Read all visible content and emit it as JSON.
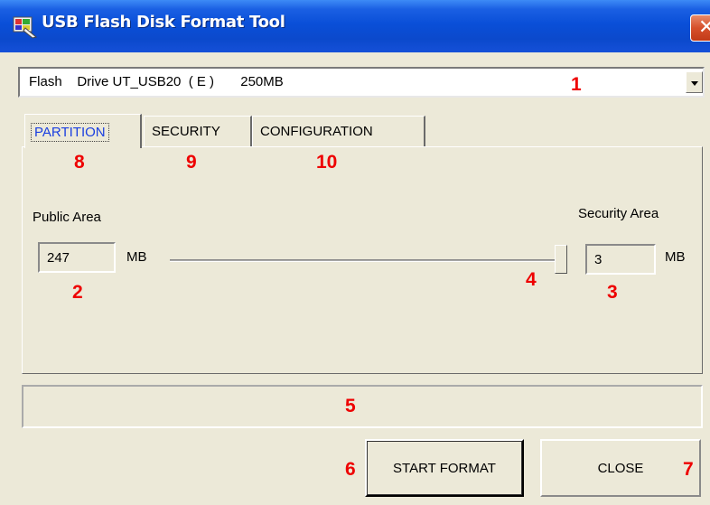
{
  "window": {
    "title": "USB Flash Disk Format Tool"
  },
  "drive": {
    "selected": "Flash    Drive UT_USB20  ( E )       250MB"
  },
  "tabs": [
    {
      "label": "PARTITION",
      "active": true
    },
    {
      "label": "SECURITY",
      "active": false
    },
    {
      "label": "CONFIGURATION",
      "active": false
    }
  ],
  "partition": {
    "public_label": "Public Area",
    "security_label": "Security Area",
    "public_value": "247",
    "security_value": "3",
    "unit": "MB",
    "slider_security_mb": 3,
    "slider_total_mb": 250
  },
  "buttons": {
    "start_format": "START FORMAT",
    "close": "CLOSE"
  },
  "annotations": [
    "1",
    "2",
    "3",
    "4",
    "5",
    "6",
    "7",
    "8",
    "9",
    "10"
  ],
  "colors": {
    "title_blue": "#0a4fd8",
    "annotation_red": "#e00000",
    "active_tab_text": "#1a3fe0",
    "face": "#ece9d8"
  }
}
